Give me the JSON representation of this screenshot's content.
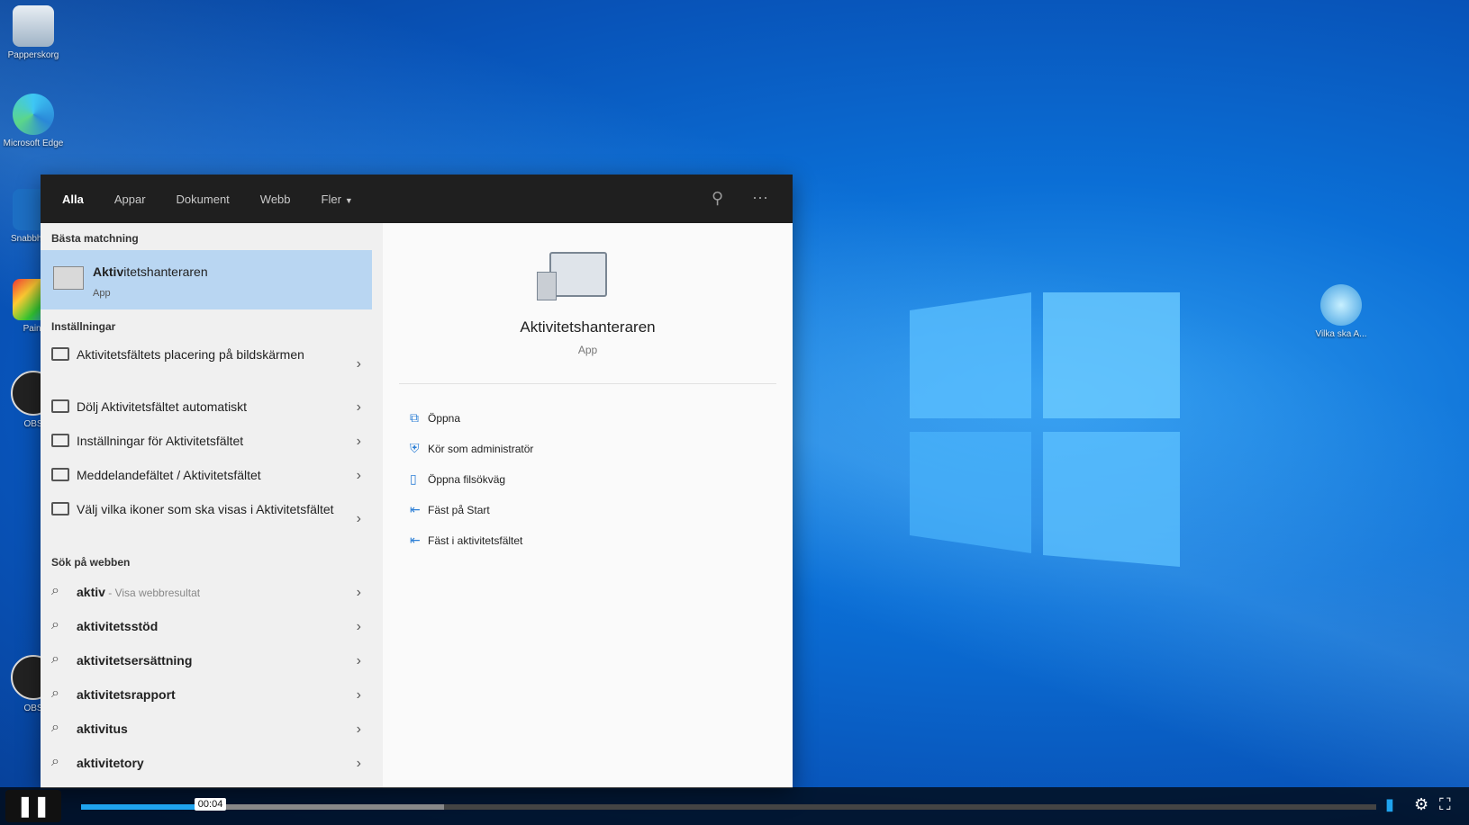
{
  "desktop": {
    "icons": [
      {
        "label": "Papperskorg"
      },
      {
        "label": "Microsoft Edge"
      },
      {
        "label": "Snabbhjälp"
      },
      {
        "label": "Paint"
      },
      {
        "label": "OBS"
      },
      {
        "label": "OBS"
      },
      {
        "label": "Vilka ska A..."
      }
    ]
  },
  "search_panel": {
    "tabs": [
      "Alla",
      "Appar",
      "Dokument",
      "Webb",
      "Fler"
    ],
    "best_match_header": "Bästa matchning",
    "best_match": {
      "title_bold": "Aktiv",
      "title_rest": "itetshanteraren",
      "type": "App"
    },
    "settings_header": "Inställningar",
    "settings": [
      {
        "text": "Aktivitetsfältets placering på bildskärmen"
      },
      {
        "text": "Dölj Aktivitetsfältet automatiskt"
      },
      {
        "text": "Inställningar för Aktivitetsfältet"
      },
      {
        "text": "Meddelandefältet / Aktivitetsfältet"
      },
      {
        "text": "Välj vilka ikoner som ska visas i Aktivitetsfältet"
      }
    ],
    "web_header": "Sök på webben",
    "web": [
      {
        "text": "aktiv",
        "suffix": " - Visa webbresultat"
      },
      {
        "text": "aktivitetsstöd",
        "suffix": ""
      },
      {
        "text": "aktivitetsersättning",
        "suffix": ""
      },
      {
        "text": "aktivitetsrapport",
        "suffix": ""
      },
      {
        "text": "aktivitus",
        "suffix": ""
      },
      {
        "text": "aktivitetory",
        "suffix": ""
      }
    ],
    "detail": {
      "name": "Aktivitetshanteraren",
      "type": "App",
      "actions": [
        {
          "label": "Öppna",
          "icon": "open-icon"
        },
        {
          "label": "Kör som administratör",
          "icon": "shield-icon"
        },
        {
          "label": "Öppna filsökväg",
          "icon": "folder-icon"
        },
        {
          "label": "Fäst på Start",
          "icon": "pin-icon"
        },
        {
          "label": "Fäst i aktivitetsfältet",
          "icon": "pin-icon"
        }
      ]
    }
  },
  "video": {
    "time": "00:04",
    "progress": 0.1,
    "buffered": 0.28,
    "accent": "#1fa3ee"
  }
}
